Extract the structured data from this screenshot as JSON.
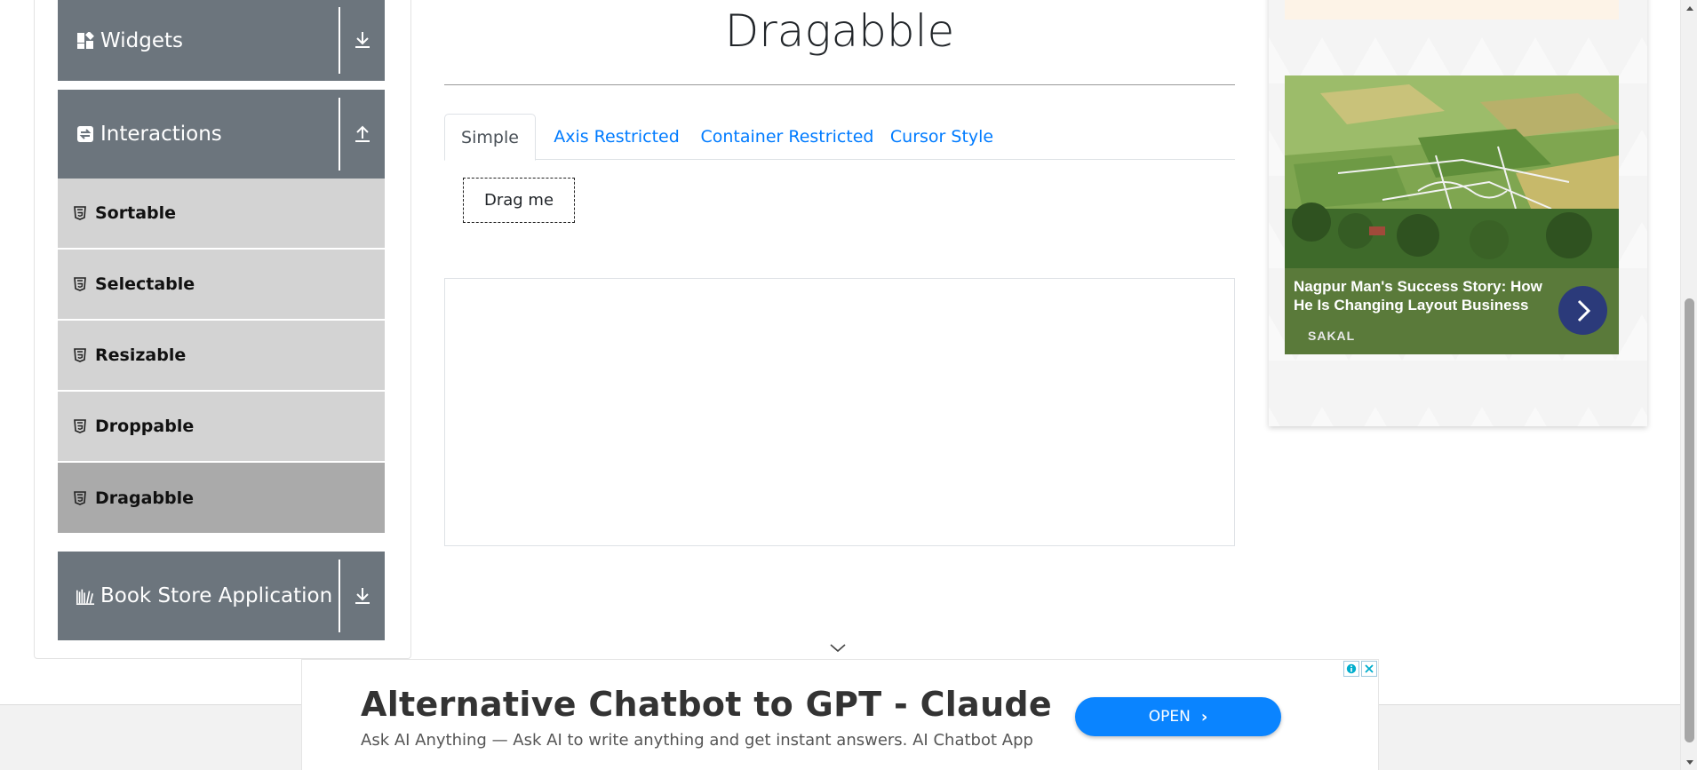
{
  "sidebar": {
    "groups": [
      {
        "title": "Widgets",
        "icon": "widgets-icon",
        "toggle": "download-icon"
      },
      {
        "title": "Interactions",
        "icon": "interactions-icon",
        "toggle": "upload-icon"
      },
      {
        "title": "Book Store Application",
        "icon": "book-store-icon",
        "toggle": "download-icon"
      }
    ],
    "items": [
      {
        "label": "Sortable"
      },
      {
        "label": "Selectable"
      },
      {
        "label": "Resizable"
      },
      {
        "label": "Droppable"
      },
      {
        "label": "Dragabble",
        "active": true
      }
    ]
  },
  "main": {
    "title": "Dragabble",
    "tabs": [
      {
        "label": "Simple",
        "active": true
      },
      {
        "label": "Axis Restricted"
      },
      {
        "label": "Container Restricted"
      },
      {
        "label": "Cursor Style"
      }
    ],
    "drag_box_label": "Drag me"
  },
  "right_ad": {
    "headline": "Nagpur Man's Success Story: How He Is Changing Layout Business",
    "source": "SAKAL"
  },
  "bottom_ad": {
    "title": "Alternative Chatbot to GPT - Claude",
    "subtitle": "Ask AI Anything — Ask AI to write anything and get instant answers. AI Chatbot App",
    "button": "OPEN"
  },
  "colors": {
    "sidebar_header": "#6c757d",
    "sidebar_item": "#d3d3d3",
    "sidebar_item_active": "#aaaaaa",
    "link": "#007bff",
    "ad_button": "#0a84ff"
  }
}
